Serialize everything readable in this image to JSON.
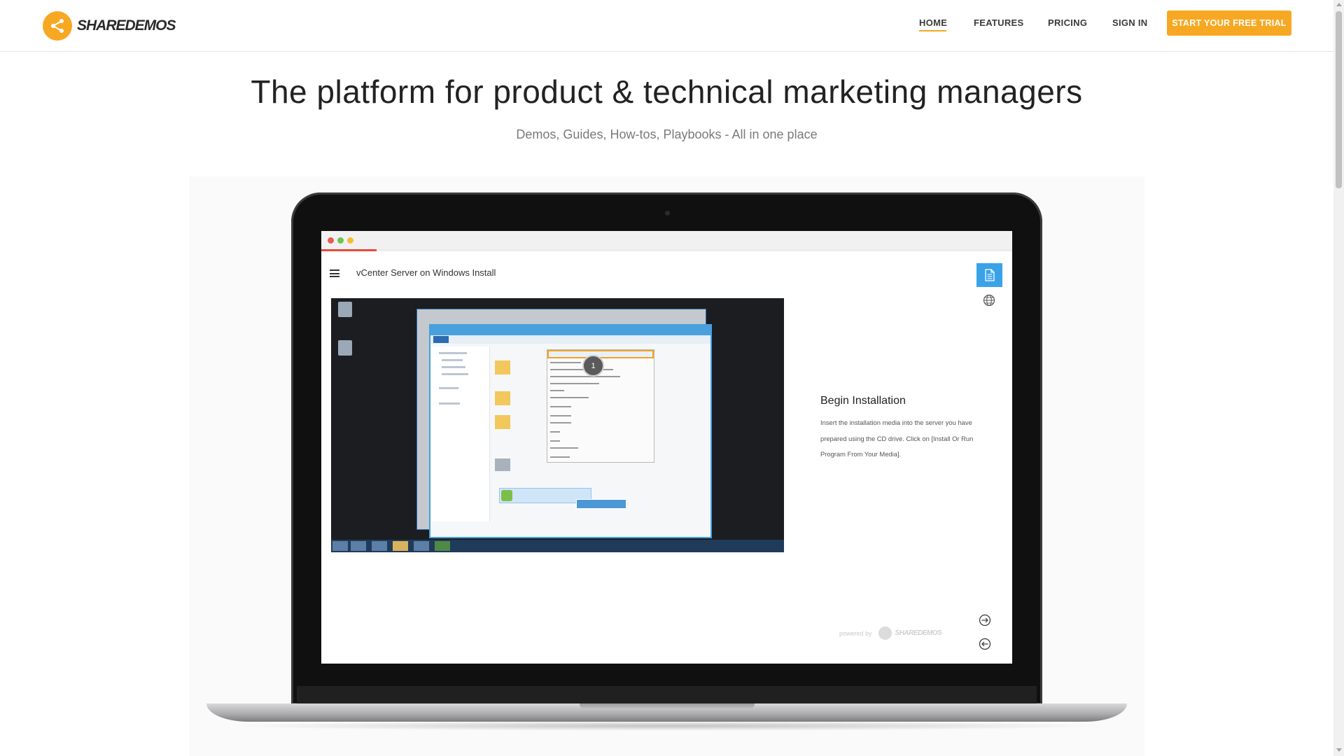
{
  "brand": {
    "name": "SHAREDEMOS"
  },
  "nav": {
    "home": "HOME",
    "features": "FEATURES",
    "pricing": "PRICING",
    "sign_in": "SIGN IN",
    "cta": "START YOUR FREE TRIAL"
  },
  "hero": {
    "title": "The platform for product & technical marketing managers",
    "subtitle": "Demos, Guides, How-tos, Playbooks - All in one place"
  },
  "demo": {
    "title": "vCenter Server on Windows Install",
    "progress": 0.08,
    "step_number": "1",
    "step_title": "Begin Installation",
    "step_description": "Insert the installation media into the server you have prepared using the CD drive. Click on [Install Or Run Program From Your Media].",
    "powered_by": "powered by",
    "powered_brand": "SHAREDEMOS"
  },
  "colors": {
    "accent": "#f7a823",
    "doc_button": "#3aa3e8",
    "progress_bar": "#e64a3c"
  },
  "icons": {
    "logo": "share-icon",
    "menu": "hamburger-icon",
    "document": "document-icon",
    "language": "globe-icon",
    "next": "arrow-right-circle-icon",
    "previous": "arrow-left-circle-icon"
  }
}
